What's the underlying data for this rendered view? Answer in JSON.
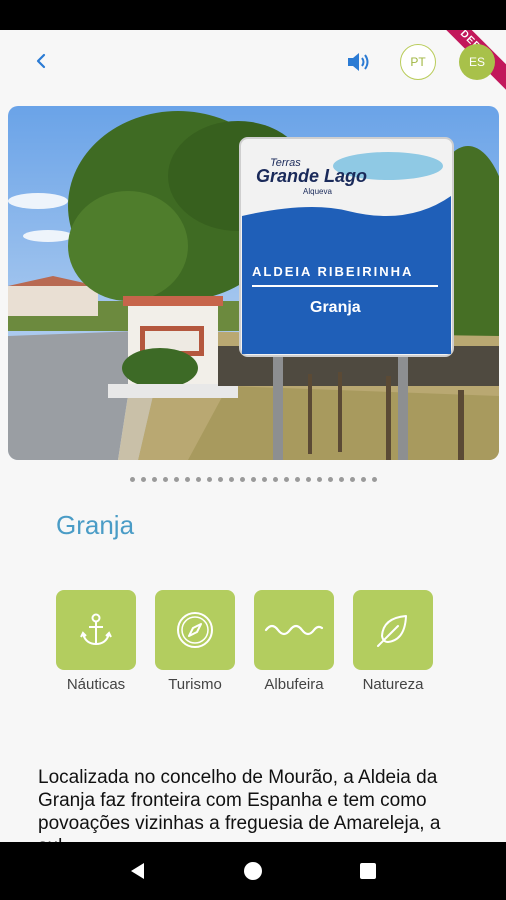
{
  "debug_ribbon": "DEBUG",
  "header": {
    "back_icon": "chevron-left-icon",
    "sound_icon": "speaker-icon",
    "languages": [
      "PT",
      "ES"
    ],
    "active_language": "ES",
    "accent_color": "#a8c14a"
  },
  "hero": {
    "sign_brand_line1": "Terras",
    "sign_brand_line2": "Grande Lago",
    "sign_brand_line3": "Alqueva",
    "sign_village": "ALDEIA RIBEIRINHA",
    "sign_place": "Granja"
  },
  "carousel": {
    "count": 23,
    "active": 0
  },
  "place": {
    "title": "Granja",
    "title_color": "#4a9cc6"
  },
  "categories": [
    {
      "label": "Náuticas",
      "icon": "anchor-icon"
    },
    {
      "label": "Turismo",
      "icon": "compass-icon"
    },
    {
      "label": "Albufeira",
      "icon": "waves-icon"
    },
    {
      "label": "Natureza",
      "icon": "leaf-icon"
    }
  ],
  "description": "Localizada no concelho de Mourão, a Aldeia da Granja faz fronteira com Espanha e tem como povoações vizinhas a freguesia de Amareleja, a sul",
  "nav": {
    "back": "back-triangle-icon",
    "home": "home-circle-icon",
    "recents": "recents-square-icon"
  }
}
